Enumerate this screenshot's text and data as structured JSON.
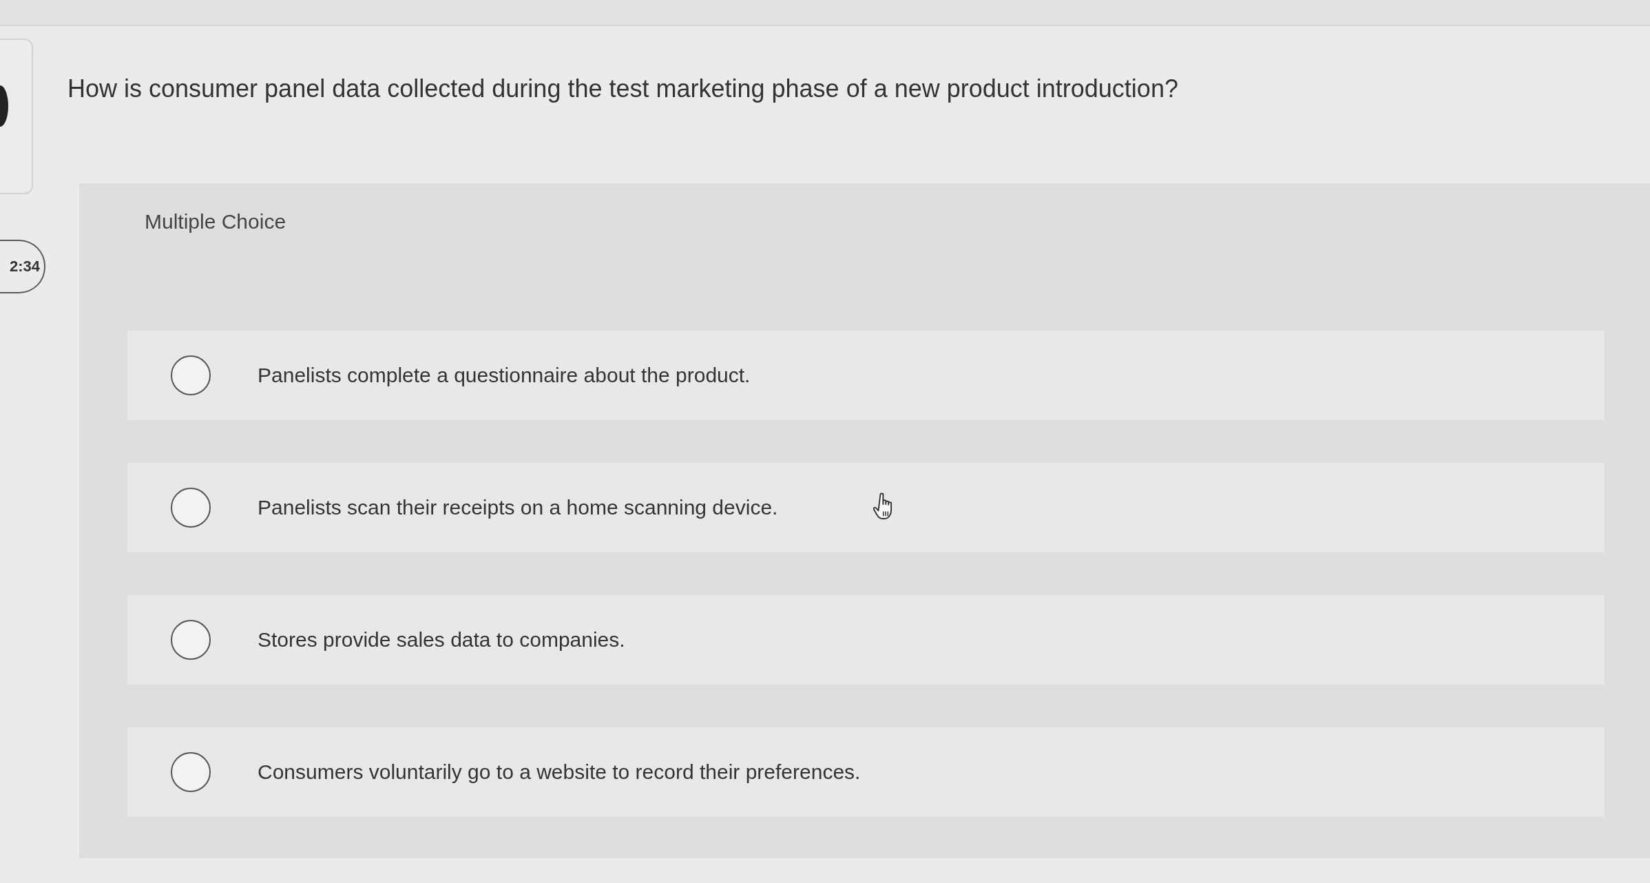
{
  "timer": {
    "text": "2:34"
  },
  "question": {
    "text": "How is consumer panel data collected during the test marketing phase of a new product introduction?"
  },
  "answer_panel": {
    "label": "Multiple Choice",
    "options": [
      {
        "text": "Panelists complete a questionnaire about the product.",
        "selected": false
      },
      {
        "text": "Panelists scan their receipts on a home scanning device.",
        "selected": false
      },
      {
        "text": "Stores provide sales data to companies.",
        "selected": false
      },
      {
        "text": "Consumers voluntarily go to a website to record their preferences.",
        "selected": false
      }
    ]
  }
}
